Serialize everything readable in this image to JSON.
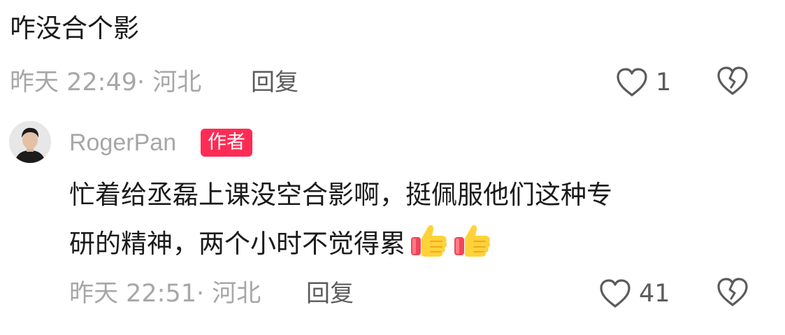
{
  "comment": {
    "text": "咋没合个影",
    "time": "昨天 22:49",
    "location": "· 河北",
    "reply_label": "回复",
    "like_count": "1"
  },
  "reply": {
    "author": "RogerPan",
    "badge": "作者",
    "text_line1": "忙着给丞磊上课没空合影啊，挺佩服他们这种专",
    "text_line2": "研的精神，两个小时不觉得累",
    "emojis": [
      "thumbs-up",
      "thumbs-up"
    ],
    "time": "昨天 22:51",
    "location": "· 河北",
    "reply_label": "回复",
    "like_count": "41"
  },
  "colors": {
    "badge_bg": "#fe2c55",
    "meta_gray": "#a7a7a7",
    "text_dark": "#1b1b1b",
    "icon_gray": "#5b5b5b"
  }
}
